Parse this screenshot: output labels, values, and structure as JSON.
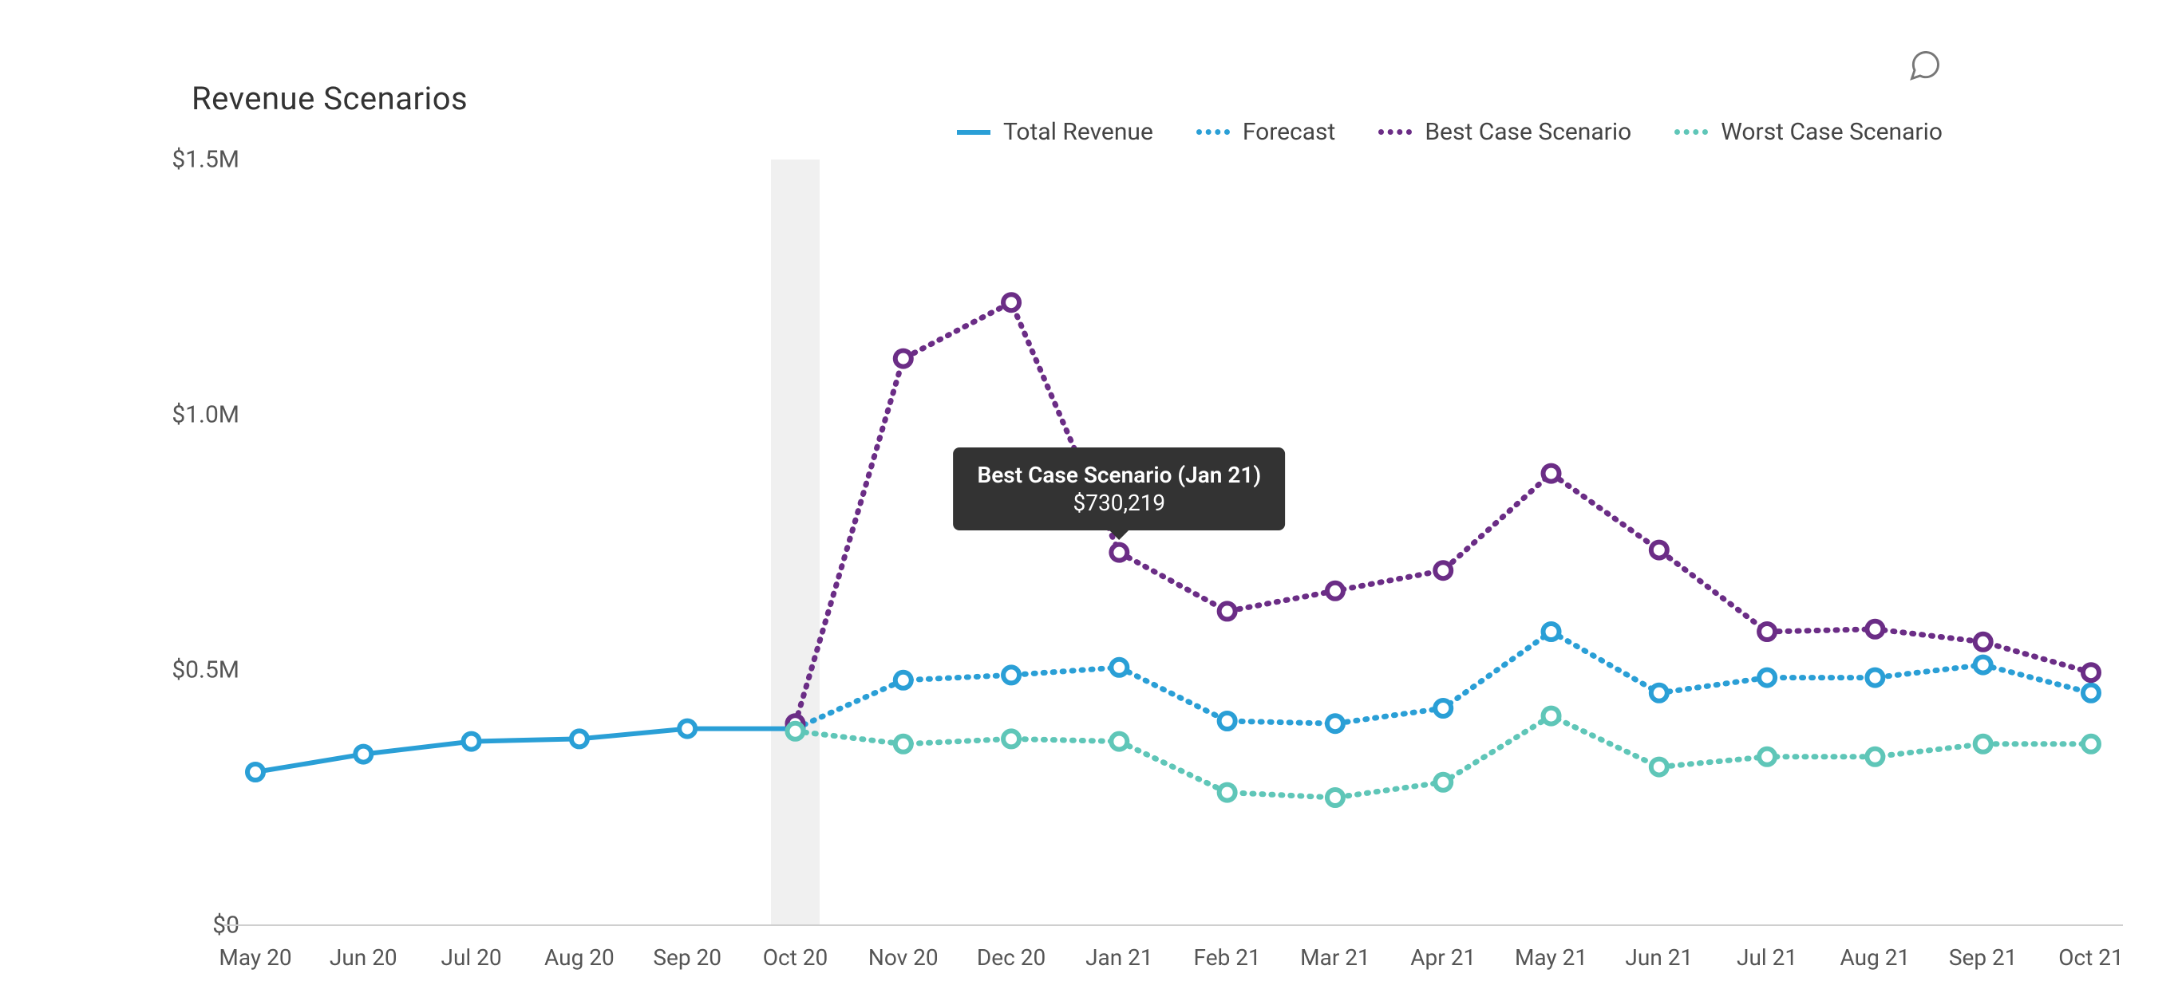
{
  "title": "Revenue Scenarios",
  "legend": {
    "total": "Total Revenue",
    "forecast": "Forecast",
    "best": "Best Case Scenario",
    "worst": "Worst Case Scenario"
  },
  "colors": {
    "total": "#2a9fd6",
    "forecast": "#2a9fd6",
    "best": "#6b2d86",
    "worst": "#5fc6b8",
    "axis": "#cfcfcf",
    "tick_text": "#555555",
    "highlight_band": "#f0f0f0"
  },
  "axes": {
    "y_ticks": [
      "$0",
      "$0.5M",
      "$1.0M",
      "$1.5M"
    ],
    "x_ticks": [
      "May 20",
      "Jun 20",
      "Jul 20",
      "Aug 20",
      "Sep 20",
      "Oct 20",
      "Nov 20",
      "Dec 20",
      "Jan 21",
      "Feb 21",
      "Mar 21",
      "Apr 21",
      "May 21",
      "Jun 21",
      "Jul 21",
      "Aug 21",
      "Sep 21",
      "Oct 21"
    ]
  },
  "tooltip": {
    "title": "Best Case Scenario (Jan 21)",
    "value": "$730,219",
    "series": "best",
    "category_index": 8
  },
  "highlight_index": 5,
  "chart_data": {
    "type": "line",
    "title": "Revenue Scenarios",
    "xlabel": "",
    "ylabel": "",
    "ylim": [
      0,
      1500000
    ],
    "categories": [
      "May 20",
      "Jun 20",
      "Jul 20",
      "Aug 20",
      "Sep 20",
      "Oct 20",
      "Nov 20",
      "Dec 20",
      "Jan 21",
      "Feb 21",
      "Mar 21",
      "Apr 21",
      "May 21",
      "Jun 21",
      "Jul 21",
      "Aug 21",
      "Sep 21",
      "Oct 21"
    ],
    "series": [
      {
        "name": "Total Revenue",
        "style": "solid",
        "color": "#2a9fd6",
        "values": [
          300000,
          335000,
          360000,
          365000,
          385000,
          385000,
          null,
          null,
          null,
          null,
          null,
          null,
          null,
          null,
          null,
          null,
          null,
          null
        ]
      },
      {
        "name": "Forecast",
        "style": "dotted",
        "color": "#2a9fd6",
        "values": [
          null,
          null,
          null,
          null,
          null,
          385000,
          480000,
          490000,
          505000,
          400000,
          395000,
          425000,
          575000,
          455000,
          485000,
          485000,
          510000,
          455000
        ]
      },
      {
        "name": "Best Case Scenario",
        "style": "dotted",
        "color": "#6b2d86",
        "values": [
          null,
          null,
          null,
          null,
          null,
          395000,
          1110000,
          1220000,
          730219,
          615000,
          655000,
          695000,
          885000,
          735000,
          575000,
          580000,
          555000,
          495000
        ]
      },
      {
        "name": "Worst Case Scenario",
        "style": "dotted",
        "color": "#5fc6b8",
        "values": [
          null,
          null,
          null,
          null,
          null,
          380000,
          355000,
          365000,
          360000,
          260000,
          250000,
          280000,
          410000,
          310000,
          330000,
          330000,
          355000,
          355000
        ]
      }
    ]
  }
}
